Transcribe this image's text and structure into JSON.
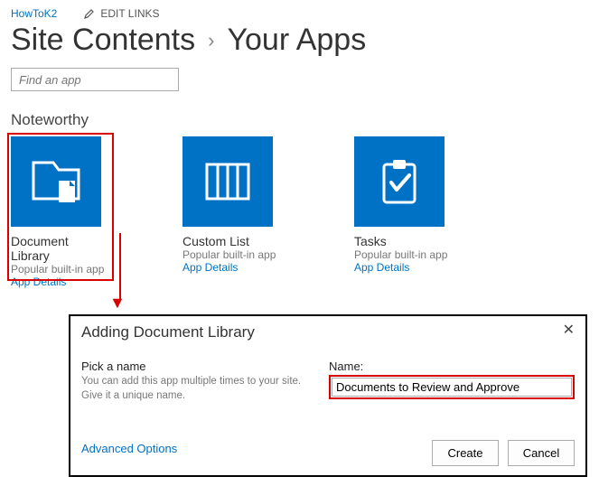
{
  "top": {
    "site_name": "HowToK2",
    "edit_links": "EDIT LINKS"
  },
  "breadcrumb": {
    "parent": "Site Contents",
    "current": "Your Apps"
  },
  "search": {
    "placeholder": "Find an app"
  },
  "section": {
    "heading": "Noteworthy"
  },
  "apps": [
    {
      "name": "Document Library",
      "sub": "Popular built-in app",
      "link": "App Details",
      "icon": "document-library"
    },
    {
      "name": "Custom List",
      "sub": "Popular built-in app",
      "link": "App Details",
      "icon": "custom-list"
    },
    {
      "name": "Tasks",
      "sub": "Popular built-in app",
      "link": "App Details",
      "icon": "tasks"
    }
  ],
  "dialog": {
    "title": "Adding Document Library",
    "pick_heading": "Pick a name",
    "pick_desc": "You can add this app multiple times to your site. Give it a unique name.",
    "name_label": "Name:",
    "name_value": "Documents to Review and Approve",
    "advanced": "Advanced Options",
    "create": "Create",
    "cancel": "Cancel"
  },
  "colors": {
    "brand": "#0072c6",
    "highlight": "#d90000"
  }
}
